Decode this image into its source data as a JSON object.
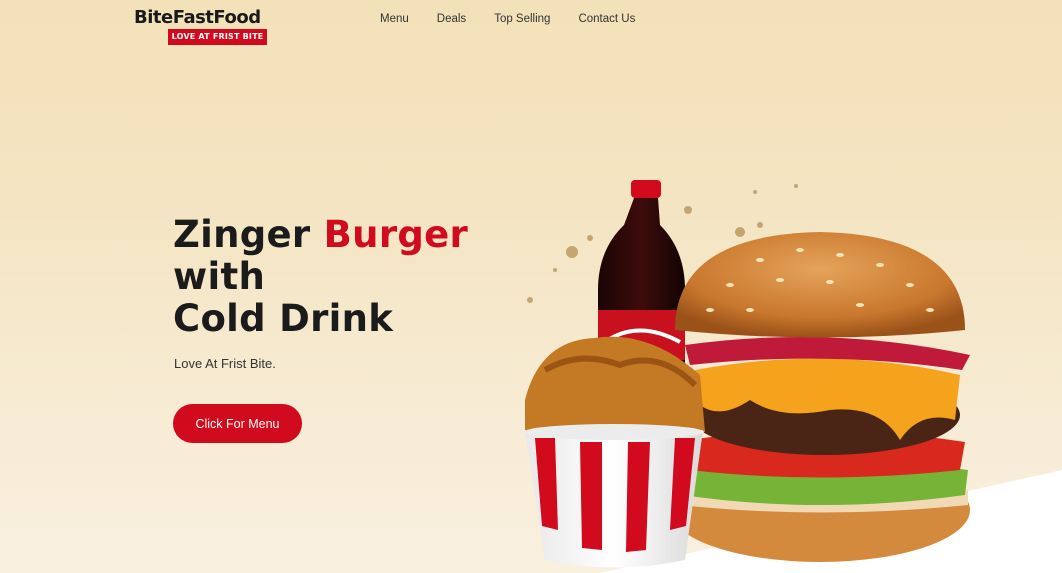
{
  "brand": {
    "name": "BiteFastFood",
    "tagline": "LOVE AT FRIST BITE"
  },
  "nav": {
    "items": [
      "Menu",
      "Deals",
      "Top Selling",
      "Contact Us"
    ]
  },
  "hero": {
    "title_part1": "Zinger ",
    "title_highlight": "Burger",
    "title_line2": "with",
    "title_line3": "Cold Drink",
    "subtitle": "Love At Frist Bite.",
    "button_label": "Click For Menu"
  },
  "colors": {
    "accent": "#d20a1e",
    "background": "#f3e1b9"
  },
  "images": {
    "hero_food": "burger-fried-chicken-bucket-cola-icon"
  }
}
